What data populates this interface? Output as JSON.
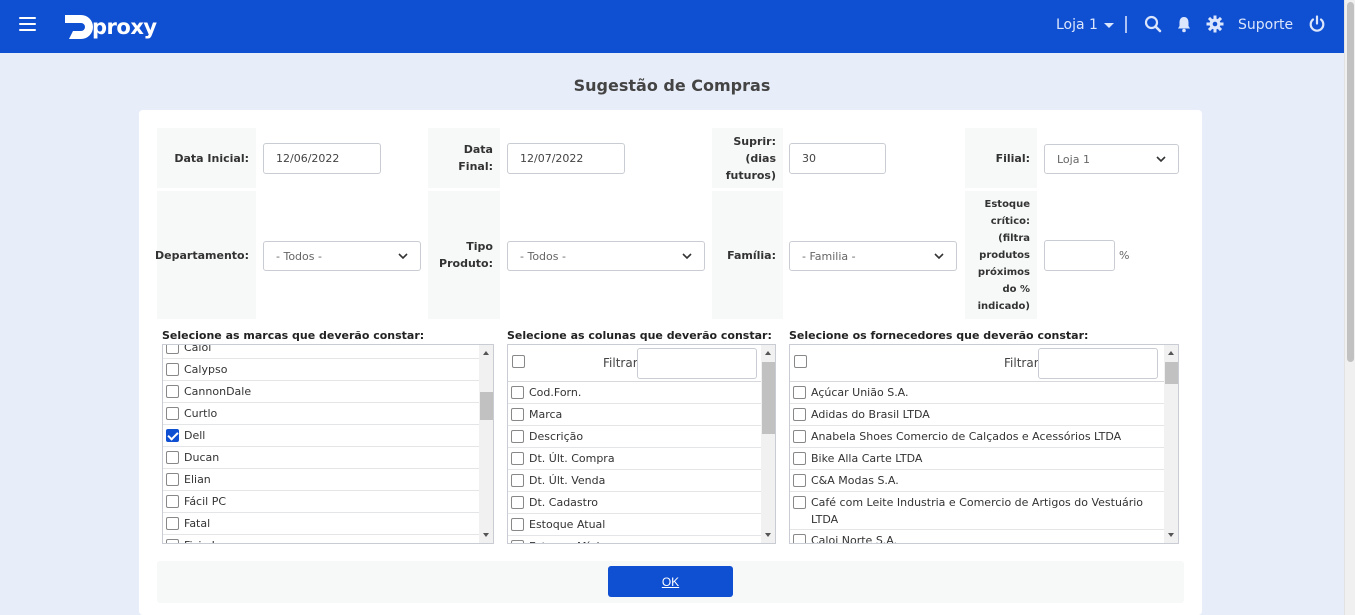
{
  "header": {
    "brand": "proxy",
    "store_selector": "Loja 1",
    "support_label": "Suporte",
    "brand_color": "#0f4fd1"
  },
  "page": {
    "title": "Sugestão de Compras"
  },
  "form": {
    "data_inicial": {
      "label": "Data Inicial:",
      "value": "12/06/2022"
    },
    "data_final": {
      "label_lines": [
        "Data",
        "Final:"
      ],
      "value": "12/07/2022"
    },
    "suprir": {
      "label_lines": [
        "Suprir:",
        "(dias",
        "futuros)"
      ],
      "value": "30"
    },
    "filial": {
      "label": "Filial:",
      "value": "Loja 1"
    },
    "departamento": {
      "label": "Departamento:",
      "value": "- Todos -"
    },
    "tipo_produto": {
      "label_lines": [
        "Tipo",
        "Produto:"
      ],
      "value": "- Todos -"
    },
    "familia": {
      "label": "Família:",
      "value": "- Familia -"
    },
    "estoque_critico": {
      "label_lines": [
        "Estoque",
        "crítico:",
        "(filtra",
        "produtos",
        "próximos",
        "do %",
        "indicado)"
      ],
      "value": "",
      "unit": "%"
    }
  },
  "marcas": {
    "label": "Selecione as marcas que deverão constar:",
    "items": [
      {
        "label": "Caloi",
        "checked": false
      },
      {
        "label": "Calypso",
        "checked": false
      },
      {
        "label": "CannonDale",
        "checked": false
      },
      {
        "label": "Curtlo",
        "checked": false
      },
      {
        "label": "Dell",
        "checked": true
      },
      {
        "label": "Ducan",
        "checked": false
      },
      {
        "label": "Elian",
        "checked": false
      },
      {
        "label": "Fácil PC",
        "checked": false
      },
      {
        "label": "Fatal",
        "checked": false
      },
      {
        "label": "Fisia L",
        "checked": false
      }
    ]
  },
  "colunas": {
    "label": "Selecione as colunas que deverão constar:",
    "filter_label": "Filtrar",
    "filter_value": "",
    "items": [
      {
        "label": "Cod.Forn.",
        "checked": false
      },
      {
        "label": "Marca",
        "checked": false
      },
      {
        "label": "Descrição",
        "checked": false
      },
      {
        "label": "Dt. Últ. Compra",
        "checked": false
      },
      {
        "label": "Dt. Últ. Venda",
        "checked": false
      },
      {
        "label": "Dt. Cadastro",
        "checked": false
      },
      {
        "label": "Estoque Atual",
        "checked": false
      },
      {
        "label": "Estoque Mínimo",
        "checked": false
      }
    ]
  },
  "fornecedores": {
    "label": "Selecione os fornecedores que deverão constar:",
    "filter_label": "Filtrar",
    "filter_value": "",
    "items": [
      {
        "label": "Açúcar União S.A.",
        "checked": false
      },
      {
        "label": "Adidas do Brasil LTDA",
        "checked": false
      },
      {
        "label": "Anabela Shoes Comercio de Calçados e Acessórios LTDA",
        "checked": false
      },
      {
        "label": "Bike Alla Carte LTDA",
        "checked": false
      },
      {
        "label": "C&A Modas S.A.",
        "checked": false
      },
      {
        "label": "Café com Leite Industria e Comercio de Artigos do Vestuário LTDA",
        "checked": false
      },
      {
        "label": "Caloi Norte S.A.",
        "checked": false
      }
    ]
  },
  "actions": {
    "ok_label": "OK"
  }
}
